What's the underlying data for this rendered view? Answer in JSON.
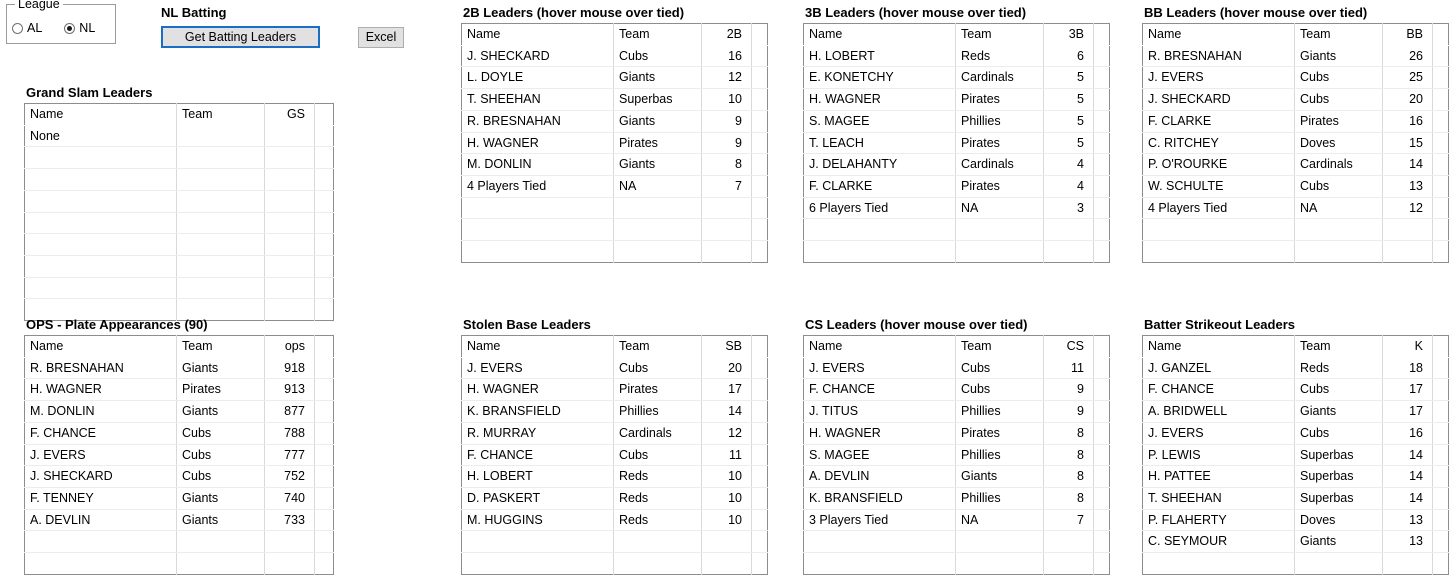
{
  "league_group": {
    "legend": "League",
    "options": [
      {
        "label": "AL",
        "selected": false
      },
      {
        "label": "NL",
        "selected": true
      }
    ]
  },
  "header": {
    "title": "NL Batting",
    "get_button": "Get Batting Leaders",
    "excel_button": "Excel"
  },
  "tables": [
    {
      "id": "grand-slam",
      "title": "Grand Slam Leaders",
      "columns": [
        "Name",
        "Team",
        "GS"
      ],
      "rows": [
        [
          "None",
          "",
          ""
        ]
      ],
      "empty_rows": 8
    },
    {
      "id": "doubles",
      "title": "2B Leaders (hover mouse over tied)",
      "columns": [
        "Name",
        "Team",
        "2B"
      ],
      "rows": [
        [
          "J. SHECKARD",
          "Cubs",
          "16"
        ],
        [
          "L. DOYLE",
          "Giants",
          "12"
        ],
        [
          "T. SHEEHAN",
          "Superbas",
          "10"
        ],
        [
          "R. BRESNAHAN",
          "Giants",
          "9"
        ],
        [
          "H. WAGNER",
          "Pirates",
          "9"
        ],
        [
          "M. DONLIN",
          "Giants",
          "8"
        ],
        [
          "4 Players Tied",
          "NA",
          "7"
        ]
      ],
      "empty_rows": 3
    },
    {
      "id": "triples",
      "title": "3B Leaders (hover mouse over tied)",
      "columns": [
        "Name",
        "Team",
        "3B"
      ],
      "rows": [
        [
          "H. LOBERT",
          "Reds",
          "6"
        ],
        [
          "E. KONETCHY",
          "Cardinals",
          "5"
        ],
        [
          "H. WAGNER",
          "Pirates",
          "5"
        ],
        [
          "S. MAGEE",
          "Phillies",
          "5"
        ],
        [
          "T. LEACH",
          "Pirates",
          "5"
        ],
        [
          "J. DELAHANTY",
          "Cardinals",
          "4"
        ],
        [
          "F. CLARKE",
          "Pirates",
          "4"
        ],
        [
          "6 Players Tied",
          "NA",
          "3"
        ]
      ],
      "empty_rows": 2
    },
    {
      "id": "walks",
      "title": "BB Leaders (hover mouse over tied)",
      "columns": [
        "Name",
        "Team",
        "BB"
      ],
      "rows": [
        [
          "R. BRESNAHAN",
          "Giants",
          "26"
        ],
        [
          "J. EVERS",
          "Cubs",
          "25"
        ],
        [
          "J. SHECKARD",
          "Cubs",
          "20"
        ],
        [
          "F. CLARKE",
          "Pirates",
          "16"
        ],
        [
          "C. RITCHEY",
          "Doves",
          "15"
        ],
        [
          "P. O'ROURKE",
          "Cardinals",
          "14"
        ],
        [
          "W. SCHULTE",
          "Cubs",
          "13"
        ],
        [
          "4 Players Tied",
          "NA",
          "12"
        ]
      ],
      "empty_rows": 2
    },
    {
      "id": "ops",
      "title": "OPS - Plate Appearances (90)",
      "columns": [
        "Name",
        "Team",
        "ops"
      ],
      "rows": [
        [
          "R. BRESNAHAN",
          "Giants",
          "918"
        ],
        [
          "H. WAGNER",
          "Pirates",
          "913"
        ],
        [
          "M. DONLIN",
          "Giants",
          "877"
        ],
        [
          "F. CHANCE",
          "Cubs",
          "788"
        ],
        [
          "J. EVERS",
          "Cubs",
          "777"
        ],
        [
          "J. SHECKARD",
          "Cubs",
          "752"
        ],
        [
          "F. TENNEY",
          "Giants",
          "740"
        ],
        [
          "A. DEVLIN",
          "Giants",
          "733"
        ]
      ],
      "empty_rows": 2
    },
    {
      "id": "stolen-bases",
      "title": "Stolen Base Leaders",
      "columns": [
        "Name",
        "Team",
        "SB"
      ],
      "rows": [
        [
          "J. EVERS",
          "Cubs",
          "20"
        ],
        [
          "H. WAGNER",
          "Pirates",
          "17"
        ],
        [
          "K. BRANSFIELD",
          "Phillies",
          "14"
        ],
        [
          "R. MURRAY",
          "Cardinals",
          "12"
        ],
        [
          "F. CHANCE",
          "Cubs",
          "11"
        ],
        [
          "H. LOBERT",
          "Reds",
          "10"
        ],
        [
          "D. PASKERT",
          "Reds",
          "10"
        ],
        [
          "M. HUGGINS",
          "Reds",
          "10"
        ]
      ],
      "empty_rows": 2
    },
    {
      "id": "caught-stealing",
      "title": "CS Leaders (hover mouse over tied)",
      "columns": [
        "Name",
        "Team",
        "CS"
      ],
      "rows": [
        [
          "J. EVERS",
          "Cubs",
          "11"
        ],
        [
          "F. CHANCE",
          "Cubs",
          "9"
        ],
        [
          "J. TITUS",
          "Phillies",
          "9"
        ],
        [
          "H. WAGNER",
          "Pirates",
          "8"
        ],
        [
          "S. MAGEE",
          "Phillies",
          "8"
        ],
        [
          "A. DEVLIN",
          "Giants",
          "8"
        ],
        [
          "K. BRANSFIELD",
          "Phillies",
          "8"
        ],
        [
          "3 Players Tied",
          "NA",
          "7"
        ]
      ],
      "empty_rows": 2
    },
    {
      "id": "strikeouts",
      "title": "Batter Strikeout Leaders",
      "columns": [
        "Name",
        "Team",
        "K"
      ],
      "rows": [
        [
          "J. GANZEL",
          "Reds",
          "18"
        ],
        [
          "F. CHANCE",
          "Cubs",
          "17"
        ],
        [
          "A. BRIDWELL",
          "Giants",
          "17"
        ],
        [
          "J. EVERS",
          "Cubs",
          "16"
        ],
        [
          "P. LEWIS",
          "Superbas",
          "14"
        ],
        [
          "H. PATTEE",
          "Superbas",
          "14"
        ],
        [
          "T. SHEEHAN",
          "Superbas",
          "14"
        ],
        [
          "P. FLAHERTY",
          "Doves",
          "13"
        ],
        [
          "C. SEYMOUR",
          "Giants",
          "13"
        ]
      ],
      "empty_rows": 1
    }
  ]
}
